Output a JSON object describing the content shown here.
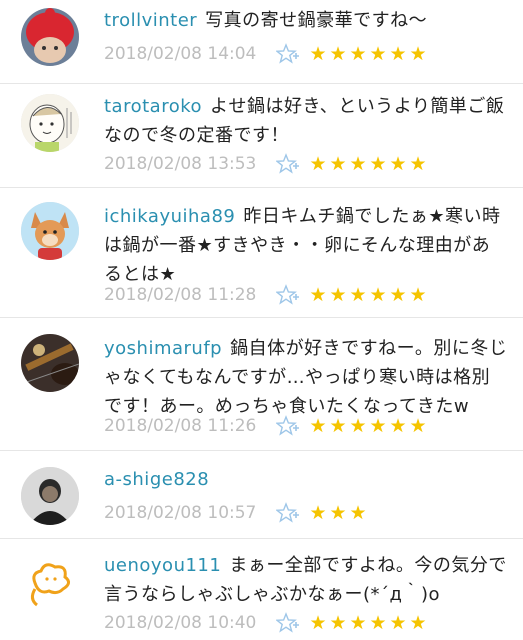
{
  "comments": [
    {
      "username": "trollvinter",
      "text": "写真の寄せ鍋豪華ですね〜",
      "timestamp": "2018/02/08 14:04",
      "stars": 6,
      "avatar_icon": "red-knit-hat-avatar-icon"
    },
    {
      "username": "tarotaroko",
      "text": "よせ鍋は好き、というより簡単ご飯なので冬の定番です！",
      "timestamp": "2018/02/08 13:53",
      "stars": 6,
      "avatar_icon": "drawn-child-avatar-icon"
    },
    {
      "username": "ichikayuiha89",
      "text": "昨日キムチ鍋でしたぁ★寒い時は鍋が一番★すきやき・・卵にそんな理由があるとは★",
      "timestamp": "2018/02/08 11:28",
      "stars": 6,
      "avatar_icon": "fox-avatar-icon"
    },
    {
      "username": "yoshimarufp",
      "text": "鍋自体が好きですねー。別に冬じゃなくてもなんですが…やっぱり寒い時は格別です！あー。めっちゃ食いたくなってきたw",
      "timestamp": "2018/02/08 11:26",
      "stars": 6,
      "avatar_icon": "guitar-avatar-icon"
    },
    {
      "username": "a-shige828",
      "text": "",
      "timestamp": "2018/02/08 10:57",
      "stars": 3,
      "avatar_icon": "person-photo-avatar-icon"
    },
    {
      "username": "uenoyou111",
      "text": "まぁー全部ですよね。今の気分で言うならしゃぶしゃぶかなぁー(*´д｀)o",
      "timestamp": "2018/02/08 10:40",
      "stars": 6,
      "avatar_icon": "orange-cloud-avatar-icon"
    }
  ],
  "star_glyph": "★",
  "colors": {
    "username": "#2a8fb0",
    "star": "#f5c400",
    "timestamp": "#bdbdbd",
    "fav_icon": "#9ec6e8"
  }
}
